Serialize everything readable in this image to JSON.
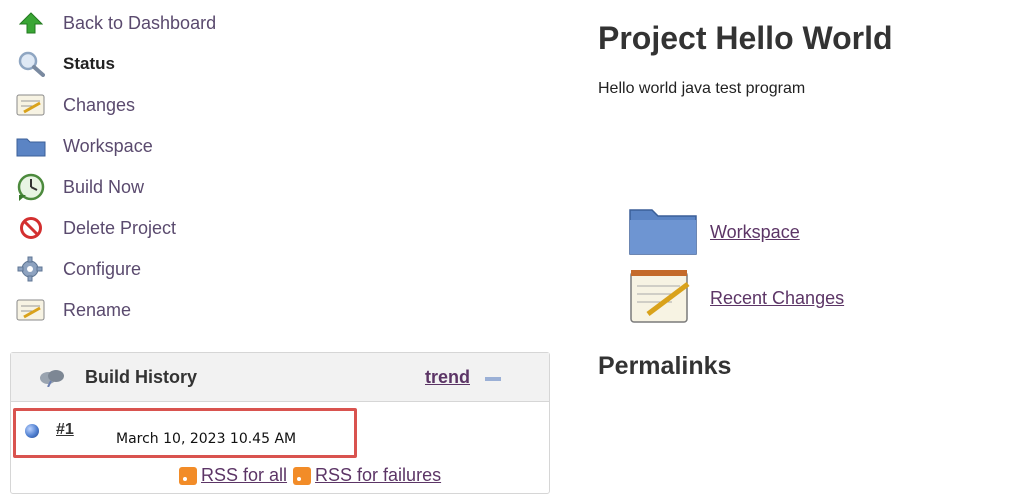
{
  "sidebar": {
    "items": [
      {
        "label": "Back to Dashboard",
        "icon": "up-arrow-icon"
      },
      {
        "label": "Status",
        "icon": "search-icon"
      },
      {
        "label": "Changes",
        "icon": "notepad-icon"
      },
      {
        "label": "Workspace",
        "icon": "folder-icon"
      },
      {
        "label": "Build Now",
        "icon": "clock-icon"
      },
      {
        "label": "Delete Project",
        "icon": "no-entry-icon"
      },
      {
        "label": "Configure",
        "icon": "gear-icon"
      },
      {
        "label": "Rename",
        "icon": "notepad-icon"
      }
    ]
  },
  "build_history": {
    "title": "Build History",
    "trend_label": "trend",
    "builds": [
      {
        "number": "#1",
        "date": "March 10, 2023 10.45 AM",
        "status_color": "#4f7fd0"
      }
    ],
    "rss_all": "RSS for all",
    "rss_failures": "RSS for failures"
  },
  "main": {
    "title": "Project Hello World",
    "description": "Hello world java test program",
    "links": [
      {
        "label": "Workspace",
        "icon": "folder-icon"
      },
      {
        "label": "Recent Changes",
        "icon": "notepad-icon"
      }
    ],
    "permalinks_heading": "Permalinks"
  },
  "colors": {
    "link": "#5c3566",
    "highlight_border": "#d9534f",
    "rss": "#f28c28"
  }
}
